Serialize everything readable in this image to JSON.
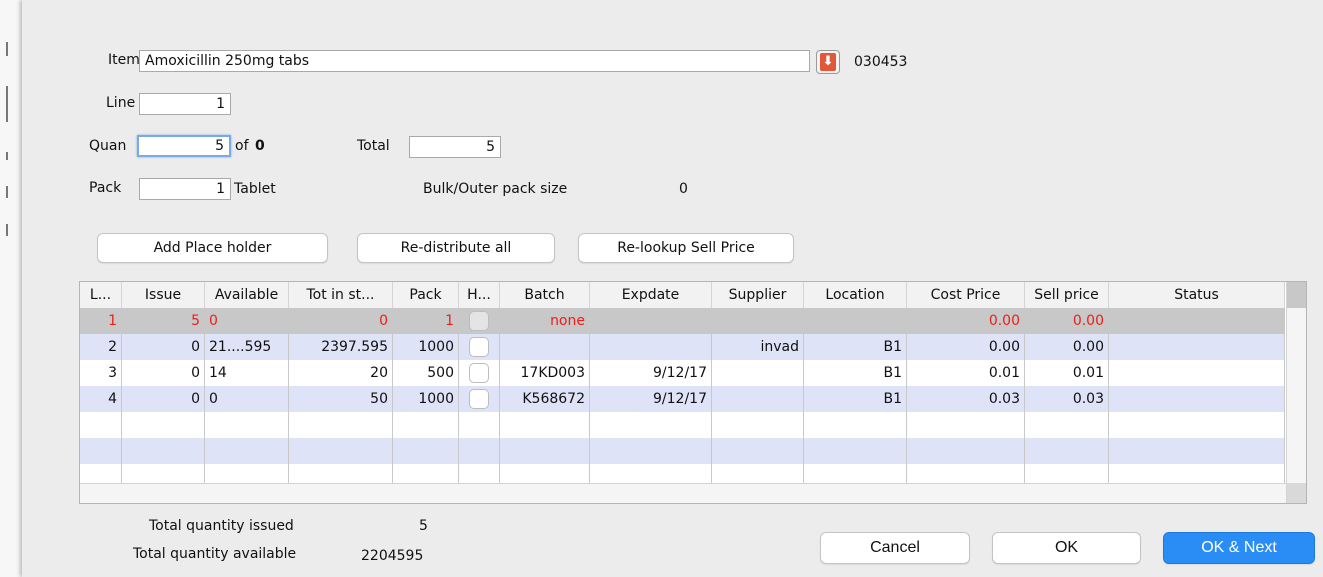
{
  "form": {
    "item_label": "Item",
    "item_value": "Amoxicillin 250mg tabs",
    "item_code": "030453",
    "line_label": "Line",
    "line_value": "1",
    "quan_label": "Quan",
    "quan_value": "5",
    "quan_of_text": "of",
    "quan_of_value": "0",
    "total_label": "Total",
    "total_value": "5",
    "pack_label": "Pack",
    "pack_value": "1",
    "pack_unit": "Tablet",
    "bulk_label": "Bulk/Outer pack size",
    "bulk_value": "0"
  },
  "actions": {
    "add_placeholder": "Add Place holder",
    "redistribute": "Re-distribute all",
    "relookup": "Re-lookup Sell Price"
  },
  "grid": {
    "headers": [
      "L...",
      "Issue",
      "Available",
      "Tot in st...",
      "Pack",
      "H...",
      "Batch",
      "Expdate",
      "Supplier",
      "Location",
      "Cost Price",
      "Sell price",
      "Status"
    ],
    "rows": [
      {
        "line": "1",
        "issue": "5",
        "available": "0",
        "tot_in_stock": "0",
        "pack": "1",
        "batch": "none",
        "expdate": "",
        "supplier": "",
        "location": "",
        "cost_price": "0.00",
        "sell_price": "0.00",
        "status": ""
      },
      {
        "line": "2",
        "issue": "0",
        "available": "21....595",
        "tot_in_stock": "2397.595",
        "pack": "1000",
        "batch": "",
        "expdate": "",
        "supplier": "invad",
        "location": "B1",
        "cost_price": "0.00",
        "sell_price": "0.00",
        "status": ""
      },
      {
        "line": "3",
        "issue": "0",
        "available": "14",
        "tot_in_stock": "20",
        "pack": "500",
        "batch": "17KD003",
        "expdate": "9/12/17",
        "supplier": "",
        "location": "B1",
        "cost_price": "0.01",
        "sell_price": "0.01",
        "status": ""
      },
      {
        "line": "4",
        "issue": "0",
        "available": "0",
        "tot_in_stock": "50",
        "pack": "1000",
        "batch": "K568672",
        "expdate": "9/12/17",
        "supplier": "",
        "location": "B1",
        "cost_price": "0.03",
        "sell_price": "0.03",
        "status": ""
      }
    ]
  },
  "summary": {
    "issued_label": "Total quantity issued",
    "issued_value": "5",
    "available_label": "Total quantity available",
    "available_value": "2204595"
  },
  "footer": {
    "cancel": "Cancel",
    "ok": "OK",
    "ok_next": "OK & Next"
  },
  "colors": {
    "selected_row_bg": "#c8c8c8",
    "alt_row_bg": "#dfe3f8",
    "error_text": "#e8201a",
    "primary_button": "#2a8cf5"
  },
  "icons": {
    "lookup": "down-arrow-icon"
  }
}
